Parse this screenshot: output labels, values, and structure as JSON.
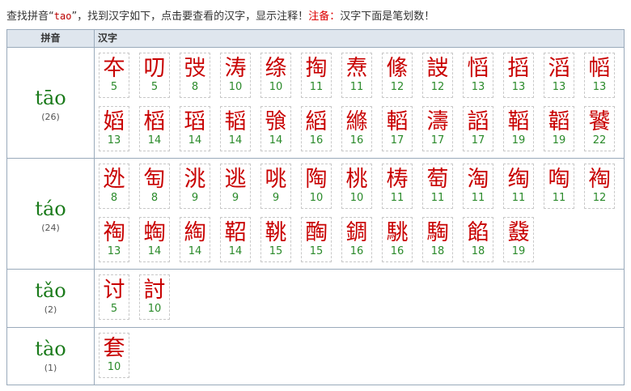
{
  "info": {
    "p1": "查找拼音“",
    "query": "tao",
    "p2": "”，找到汉字如下，点击要查看的汉字，显示注释！",
    "note_label": "注备：",
    "note": "汉字下面是笔划数！"
  },
  "header": {
    "pinyin": "拼音",
    "hanzi": "汉字"
  },
  "groups": [
    {
      "pinyin": "tāo",
      "count": "(26)",
      "chars": [
        {
          "c": "夲",
          "s": "5"
        },
        {
          "c": "叨",
          "s": "5"
        },
        {
          "c": "弢",
          "s": "8"
        },
        {
          "c": "涛",
          "s": "10"
        },
        {
          "c": "绦",
          "s": "10"
        },
        {
          "c": "掏",
          "s": "11"
        },
        {
          "c": "焘",
          "s": "11"
        },
        {
          "c": "絛",
          "s": "12"
        },
        {
          "c": "詜",
          "s": "12"
        },
        {
          "c": "慆",
          "s": "13"
        },
        {
          "c": "搯",
          "s": "13"
        },
        {
          "c": "滔",
          "s": "13"
        },
        {
          "c": "幍",
          "s": "13"
        },
        {
          "c": "嫍",
          "s": "13"
        },
        {
          "c": "槄",
          "s": "14"
        },
        {
          "c": "瑫",
          "s": "14"
        },
        {
          "c": "韬",
          "s": "14"
        },
        {
          "c": "飸",
          "s": "14"
        },
        {
          "c": "縚",
          "s": "16"
        },
        {
          "c": "縧",
          "s": "16"
        },
        {
          "c": "轁",
          "s": "17"
        },
        {
          "c": "濤",
          "s": "17"
        },
        {
          "c": "謟",
          "s": "17"
        },
        {
          "c": "鞱",
          "s": "19"
        },
        {
          "c": "韜",
          "s": "19"
        },
        {
          "c": "饕",
          "s": "22"
        }
      ]
    },
    {
      "pinyin": "táo",
      "count": "(24)",
      "chars": [
        {
          "c": "迯",
          "s": "8"
        },
        {
          "c": "匋",
          "s": "8"
        },
        {
          "c": "洮",
          "s": "9"
        },
        {
          "c": "逃",
          "s": "9"
        },
        {
          "c": "咷",
          "s": "9"
        },
        {
          "c": "陶",
          "s": "10"
        },
        {
          "c": "桃",
          "s": "10"
        },
        {
          "c": "梼",
          "s": "11"
        },
        {
          "c": "萄",
          "s": "11"
        },
        {
          "c": "淘",
          "s": "11"
        },
        {
          "c": "绹",
          "s": "11"
        },
        {
          "c": "啕",
          "s": "11"
        },
        {
          "c": "裪",
          "s": "12"
        },
        {
          "c": "祹",
          "s": "13"
        },
        {
          "c": "蜪",
          "s": "14"
        },
        {
          "c": "綯",
          "s": "14"
        },
        {
          "c": "鞀",
          "s": "14"
        },
        {
          "c": "鞉",
          "s": "15"
        },
        {
          "c": "醄",
          "s": "15"
        },
        {
          "c": "錭",
          "s": "16"
        },
        {
          "c": "駣",
          "s": "16"
        },
        {
          "c": "騊",
          "s": "18"
        },
        {
          "c": "餡",
          "s": "18"
        },
        {
          "c": "鼗",
          "s": "19"
        }
      ]
    },
    {
      "pinyin": "tǎo",
      "count": "(2)",
      "chars": [
        {
          "c": "讨",
          "s": "5"
        },
        {
          "c": "討",
          "s": "10"
        }
      ]
    },
    {
      "pinyin": "tào",
      "count": "(1)",
      "chars": [
        {
          "c": "套",
          "s": "10"
        }
      ]
    }
  ]
}
